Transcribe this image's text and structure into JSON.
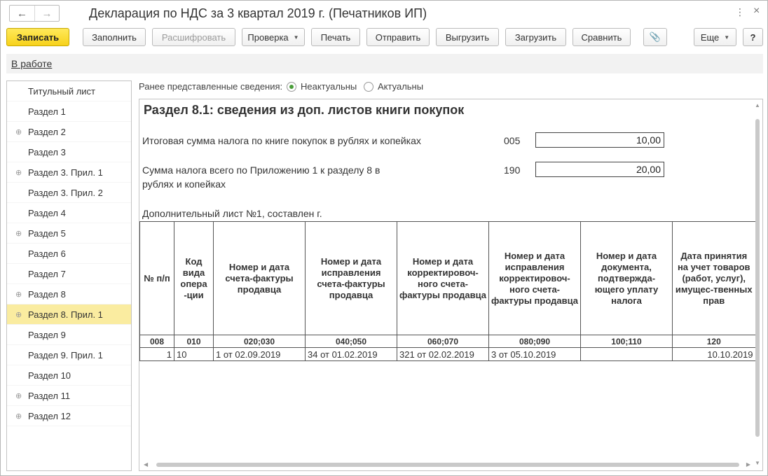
{
  "window": {
    "title": "Декларация по НДС за 3 квартал 2019 г. (Печатников ИП)",
    "back_icon": "←",
    "forward_icon": "→",
    "more_icon": "⋮",
    "close_icon": "×"
  },
  "toolbar": {
    "save": "Записать",
    "fill": "Заполнить",
    "decode": "Расшифровать",
    "check": "Проверка",
    "print": "Печать",
    "send": "Отправить",
    "export": "Выгрузить",
    "import": "Загрузить",
    "compare": "Сравнить",
    "attach_icon": "📎",
    "more": "Еще",
    "help": "?"
  },
  "status": {
    "link": "В работе"
  },
  "sidebar": {
    "items": [
      {
        "label": "Титульный лист",
        "expandable": false
      },
      {
        "label": "Раздел 1",
        "expandable": false
      },
      {
        "label": "Раздел 2",
        "expandable": true
      },
      {
        "label": "Раздел 3",
        "expandable": false
      },
      {
        "label": "Раздел 3. Прил. 1",
        "expandable": true
      },
      {
        "label": "Раздел 3. Прил. 2",
        "expandable": false
      },
      {
        "label": "Раздел 4",
        "expandable": false
      },
      {
        "label": "Раздел 5",
        "expandable": true
      },
      {
        "label": "Раздел 6",
        "expandable": false
      },
      {
        "label": "Раздел 7",
        "expandable": false
      },
      {
        "label": "Раздел 8",
        "expandable": true
      },
      {
        "label": "Раздел 8. Прил. 1",
        "expandable": true,
        "active": true
      },
      {
        "label": "Раздел 9",
        "expandable": false
      },
      {
        "label": "Раздел 9. Прил. 1",
        "expandable": false
      },
      {
        "label": "Раздел 10",
        "expandable": false
      },
      {
        "label": "Раздел 11",
        "expandable": true
      },
      {
        "label": "Раздел 12",
        "expandable": true
      }
    ]
  },
  "previous_info": {
    "label": "Ранее представленные сведения:",
    "options": [
      "Неактуальны",
      "Актуальны"
    ],
    "selected": "Неактуальны"
  },
  "section": {
    "title": "Раздел 8.1: сведения из доп. листов книги покупок",
    "fields": [
      {
        "label_line1": "Итоговая сумма налога по книге покупок в рублях и копейках",
        "label_line2": "",
        "code": "005",
        "value": "10,00"
      },
      {
        "label_line1": "Сумма налога всего по Приложению 1 к разделу 8 в",
        "label_line2": "рублях и копейках",
        "code": "190",
        "value": "20,00"
      }
    ],
    "additional_sheet": "Дополнительный лист №1, составлен  г."
  },
  "table": {
    "headers": [
      "№ п/п",
      "Код вида опера -ции",
      "Номер и дата счета-фактуры продавца",
      "Номер и дата исправления счета-фактуры продавца",
      "Номер и дата корректировоч-ного счета-фактуры продавца",
      "Номер и дата исправления корректировоч-ного счета-фактуры продавца",
      "Номер и дата документа, подтвержда-ющего уплату налога",
      "Дата принятия на учет товаров (работ, услуг), имущес-твенных прав"
    ],
    "codes": [
      "008",
      "010",
      "020;030",
      "040;050",
      "060;070",
      "080;090",
      "100;110",
      "120"
    ],
    "rows": [
      [
        "1",
        "10",
        "1 от 02.09.2019",
        "34 от 01.02.2019",
        "321 от 02.02.2019",
        "3 от 05.10.2019",
        "",
        "10.10.2019"
      ]
    ]
  }
}
